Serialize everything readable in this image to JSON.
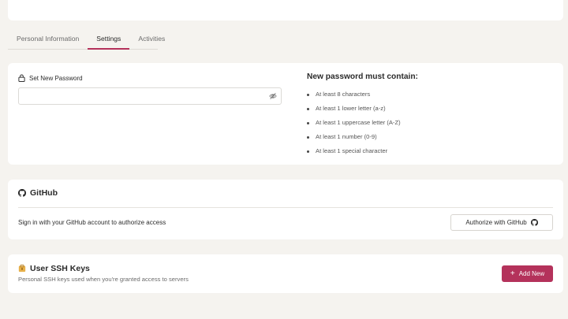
{
  "tabs": [
    {
      "label": "Personal Information",
      "active": false
    },
    {
      "label": "Settings",
      "active": true
    },
    {
      "label": "Activities",
      "active": false
    }
  ],
  "password": {
    "label": "Set New Password",
    "value": "",
    "placeholder": "",
    "requirements_title": "New password must contain:",
    "requirements": [
      "At least 8 characters",
      "At least 1 lower letter (a-z)",
      "At least 1 uppercase letter (A-Z)",
      "At least 1 number (0-9)",
      "At least 1 special character"
    ]
  },
  "github": {
    "title": "GitHub",
    "description": "Sign in with your GitHub account to authorize access",
    "button_label": "Authorize with GitHub"
  },
  "ssh": {
    "title": "User SSH Keys",
    "description": "Personal SSH keys used when you're granted access to servers",
    "add_button_label": "Add New"
  },
  "colors": {
    "accent": "#b4325b",
    "background": "#f5f3ef",
    "card": "#ffffff"
  },
  "icons": [
    "lock-icon",
    "eye-off-icon",
    "github-icon",
    "key-icon",
    "plus-icon"
  ]
}
